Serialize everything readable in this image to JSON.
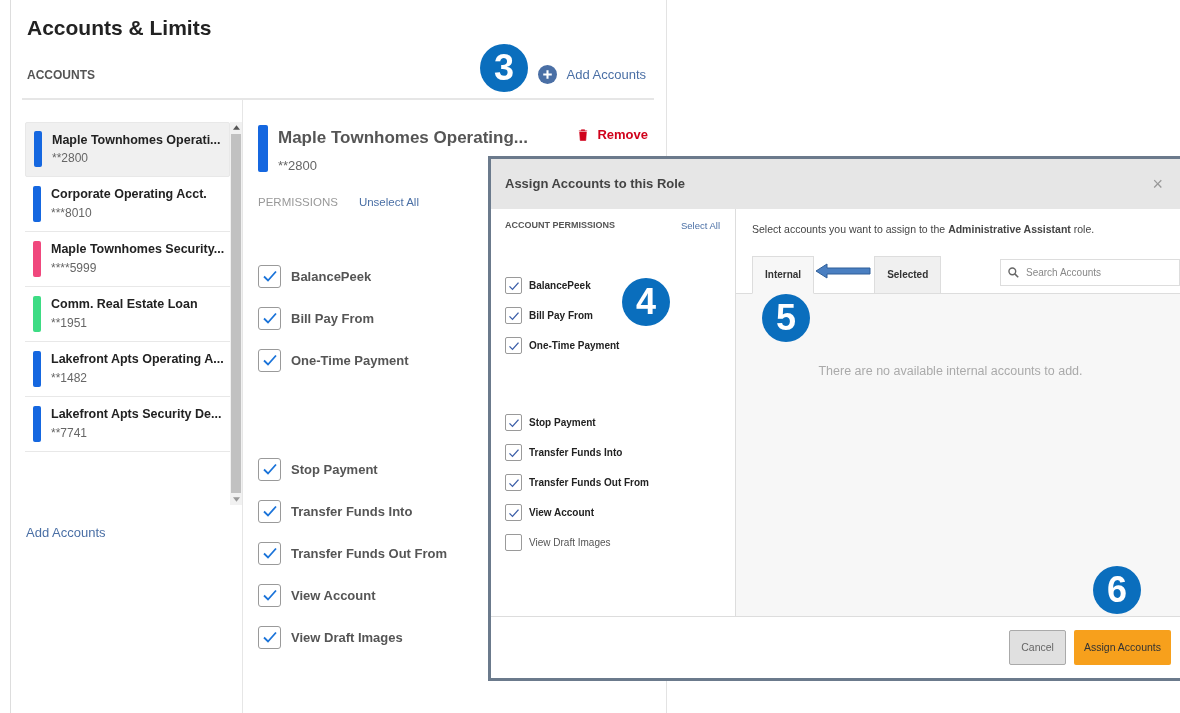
{
  "page": {
    "title": "Accounts & Limits",
    "section_label": "ACCOUNTS",
    "add_accounts_link": "Add Accounts",
    "bottom_add_accounts_link": "Add Accounts"
  },
  "accounts": [
    {
      "name": "Maple Townhomes Operati...",
      "number": "**2800",
      "color": "#1567e0",
      "selected": true
    },
    {
      "name": "Corporate Operating Acct.",
      "number": "***8010",
      "color": "#1567e0",
      "selected": false
    },
    {
      "name": "Maple Townhomes Security...",
      "number": "****5999",
      "color": "#f0487d",
      "selected": false
    },
    {
      "name": "Comm. Real Estate Loan",
      "number": "**1951",
      "color": "#3ddc84",
      "selected": false
    },
    {
      "name": "Lakefront Apts Operating A...",
      "number": "**1482",
      "color": "#1567e0",
      "selected": false
    },
    {
      "name": "Lakefront Apts Security De...",
      "number": "**7741",
      "color": "#1567e0",
      "selected": false
    }
  ],
  "detail": {
    "title": "Maple Townhomes Operating...",
    "number": "**2800",
    "color": "#1567e0",
    "remove": "Remove",
    "permissions_label": "PERMISSIONS",
    "unselect_all": "Unselect All",
    "permission_groups": [
      {
        "items": [
          {
            "label": "BalancePeek",
            "checked": true
          },
          {
            "label": "Bill Pay From",
            "checked": true
          },
          {
            "label": "One-Time Payment",
            "checked": true
          }
        ]
      },
      {
        "items": [
          {
            "label": "Stop Payment",
            "checked": true
          },
          {
            "label": "Transfer Funds Into",
            "checked": true
          },
          {
            "label": "Transfer Funds Out From",
            "checked": true
          },
          {
            "label": "View Account",
            "checked": true
          },
          {
            "label": "View Draft Images",
            "checked": true
          }
        ]
      }
    ]
  },
  "modal": {
    "title": "Assign Accounts to this Role",
    "close": "×",
    "permissions_heading": "ACCOUNT PERMISSIONS",
    "select_all": "Select All",
    "permission_groups": [
      {
        "items": [
          {
            "label": "BalancePeek",
            "checked": true
          },
          {
            "label": "Bill Pay From",
            "checked": true
          },
          {
            "label": "One-Time Payment",
            "checked": true
          }
        ]
      },
      {
        "items": [
          {
            "label": "Stop Payment",
            "checked": true
          },
          {
            "label": "Transfer Funds Into",
            "checked": true
          },
          {
            "label": "Transfer Funds Out From",
            "checked": true
          },
          {
            "label": "View Account",
            "checked": true
          },
          {
            "label": "View Draft Images",
            "checked": false
          }
        ]
      }
    ],
    "instruction": "Select accounts you want to assign to the **Administrative Assistant** role.",
    "tabs": [
      {
        "label": "Internal",
        "selected": true
      },
      {
        "label": "Selected",
        "selected": false
      }
    ],
    "search": {
      "placeholder": "Search Accounts"
    },
    "empty_message": "There are no available internal accounts to add.",
    "buttons": {
      "cancel": "Cancel",
      "assign": "Assign Accounts"
    }
  },
  "callouts": [
    "3",
    "4",
    "5",
    "6"
  ]
}
